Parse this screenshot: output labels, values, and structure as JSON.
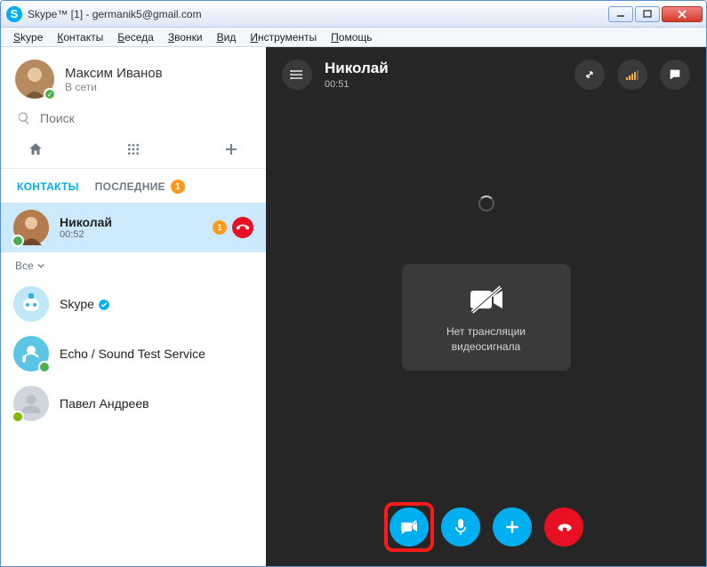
{
  "window": {
    "title": "Skype™ [1] - germanik5@gmail.com"
  },
  "menu": [
    "Skype",
    "Контакты",
    "Беседа",
    "Звонки",
    "Вид",
    "Инструменты",
    "Помощь"
  ],
  "profile": {
    "name": "Максим Иванов",
    "status": "В сети"
  },
  "search": {
    "placeholder": "Поиск"
  },
  "tabs": {
    "contacts": "КОНТАКТЫ",
    "recent": "ПОСЛЕДНИЕ",
    "recent_badge": "1"
  },
  "active_contact": {
    "name": "Николай",
    "timer": "00:52",
    "badge": "1"
  },
  "filter_label": "Все",
  "contacts": [
    {
      "name": "Skype"
    },
    {
      "name": "Echo / Sound Test Service"
    },
    {
      "name": "Павел Андреев"
    }
  ],
  "call": {
    "name": "Николай",
    "timer": "00:51",
    "no_video_line1": "Нет трансляции",
    "no_video_line2": "видеосигнала"
  }
}
